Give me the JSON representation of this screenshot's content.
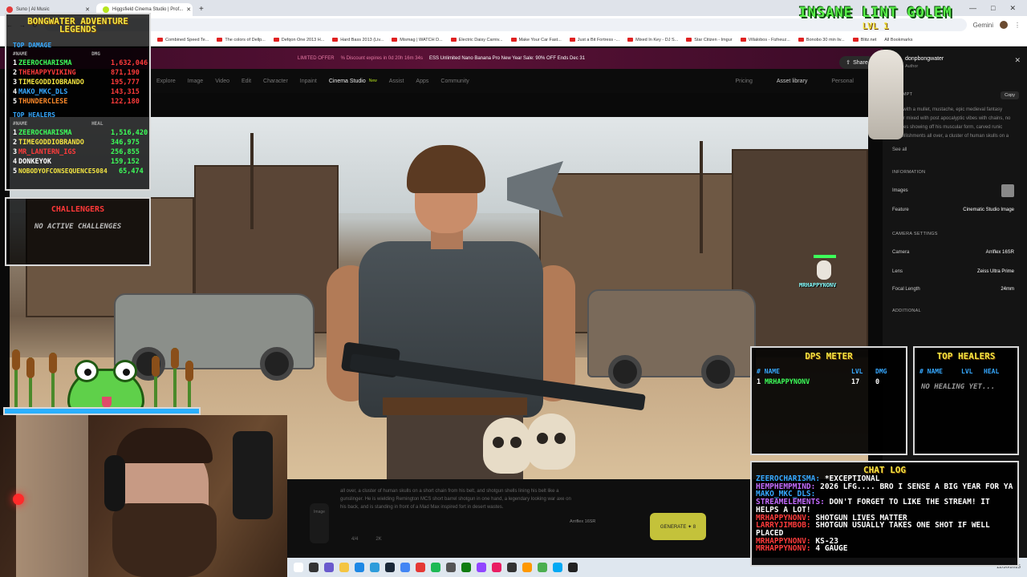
{
  "browser": {
    "tabs": [
      {
        "label": "Suno | AI Music",
        "active": false,
        "color": "#e33b3b"
      },
      {
        "label": "Higgsfield Cinema Studio | Prof...",
        "active": true,
        "color": "#b7e51e"
      }
    ],
    "new_tab": "+",
    "window_controls": [
      "—",
      "□",
      "✕"
    ],
    "bookmarks": [
      "Combined Speed Te...",
      "The colors of Dellp...",
      "Defqon One 2013 H...",
      "Hard Bass 2013 (Liv...",
      "Mismag | WATCH D...",
      "Electric Daisy Carniv...",
      "Make Your Car Fast...",
      "Just a Bit Fortress -...",
      "Mixed In Key - DJ S...",
      "Star Citizen - Imgur",
      "Villalobos - Fizheuz...",
      "Bonobo 30 min liv...",
      "Blitz.net"
    ],
    "all_bookmarks": "All Bookmarks",
    "gemini": "Gemini"
  },
  "promo": {
    "badge": "LIMITED OFFER",
    "discount": "% Discount expires in 0d 20h 16m 34s",
    "text": "ESS Unlimited Nano Banana Pro New Year Sale: 90% OFF Ends Dec 31"
  },
  "nav": {
    "items": [
      "Explore",
      "Image",
      "Video",
      "Edit",
      "Character",
      "Inpaint",
      "Cinema Studio",
      "Assist",
      "Apps",
      "Community"
    ],
    "current": "Cinema Studio",
    "new_badge": "New",
    "right": [
      "Pricing",
      "Asset library",
      "Personal"
    ],
    "share": "Share"
  },
  "side": {
    "author_name": "donpbongwater",
    "author_role": "Author",
    "prompt_label": "PROMPT",
    "copy": "Copy",
    "prompt_text": "...an with a mullet, mustache, epic medieval fantasy armor mixed with post apocalyptic vibes with chains, no sleeves showing off his muscular form, carved runic embellishments all over, a cluster of human skulls on a short chain from his",
    "see_all": "See all",
    "information_label": "INFORMATION",
    "images_label": "Images",
    "feature_label": "Feature",
    "feature_value": "Cinematic Studio Image",
    "camera_label": "CAMERA SETTINGS",
    "camera_key": "Camera",
    "camera_value": "Arriflex 16SR",
    "lens_key": "Lens",
    "lens_value": "Zeiss Ultra Prime",
    "focal_key": "Focal Length",
    "focal_value": "24mm",
    "additional_label": "ADDITIONAL"
  },
  "prompt_strip": {
    "text": "all over, a cluster of human skulls on a short chain from his belt, and shotgun shells lining his belt like a gunslinger. He is wielding Remington MCS short barrel shotgun in one hand, a legendary looking war axe on his back, and is standing in front of a Mad Max inspired fort in desert wastes.",
    "model": "Arriflex 16SR",
    "generate": "GENERATE ✦ 8",
    "pager_left": "4/4",
    "pager_right": "2K",
    "tools_label": "Image"
  },
  "taskbar": {
    "clock": "12/30/2025"
  },
  "legends": {
    "title_line1": "BONGWATER ADVENTURE",
    "title_line2": "LEGENDS",
    "damage_header": "TOP DAMAGE",
    "col_name": "#NAME",
    "col_dmg": "DMG",
    "damage": [
      {
        "rank": "1",
        "name": "ZEEROCHARISMA",
        "value": "1,632,046",
        "color": "#3dff5a"
      },
      {
        "rank": "2",
        "name": "THEHAPPYVIKING",
        "value": "871,190",
        "color": "#ff3b3b"
      },
      {
        "rank": "3",
        "name": "TIMEGODDIOBRANDO",
        "value": "195,777",
        "color": "#f4e542"
      },
      {
        "rank": "4",
        "name": "MAKO_MKC_DLS",
        "value": "143,315",
        "color": "#36a8ff"
      },
      {
        "rank": "5",
        "name": "THUNDERCLESE",
        "value": "122,180",
        "color": "#ff8a2a"
      }
    ],
    "healers_header": "TOP HEALERS",
    "col_heal": "HEAL",
    "healers": [
      {
        "rank": "1",
        "name": "ZEEROCHARISMA",
        "value": "1,516,420",
        "color": "#3dff5a"
      },
      {
        "rank": "2",
        "name": "TIMEGODDIOBRANDO",
        "value": "346,975",
        "color": "#f4e542"
      },
      {
        "rank": "3",
        "name": "MR_LANTERN_IGS",
        "value": "256,855",
        "color": "#ff3b3b"
      },
      {
        "rank": "4",
        "name": "DONKEYOK",
        "value": "159,152",
        "color": "#ffffff"
      },
      {
        "rank": "5",
        "name": "NOBODYOFCONSEQUENCE5084",
        "value": "65,474",
        "color": "#f4e542"
      }
    ]
  },
  "challenges": {
    "title": "CHALLENGERS",
    "subtitle": "NO ACTIVE CHALLENGES"
  },
  "golem": {
    "title": "INSANE LINT GOLEM",
    "level": "LVL 1"
  },
  "dps": {
    "title": "DPS METER",
    "cols": [
      "# NAME",
      "LVL",
      "DMG"
    ],
    "row": {
      "rank": "1",
      "name": "MRHAPPYNONV",
      "lvl": "17",
      "dmg": "0"
    }
  },
  "heal_panel": {
    "title": "TOP HEALERS",
    "cols": [
      "# NAME",
      "LVL",
      "HEAL"
    ],
    "empty": "NO HEALING YET..."
  },
  "chat": {
    "title": "CHAT LOG",
    "messages": [
      {
        "user": "ZEEROCHARISMA:",
        "text": "*EXCEPTIONAL",
        "color": "#36a8ff"
      },
      {
        "user": "HEMPHEMPMIND:",
        "text": "2026 LFG.... BRO I SENSE A BIG YEAR FOR YA",
        "color": "#c46bff"
      },
      {
        "user": "MAKO_MKC_DLS:",
        "text": "",
        "color": "#36a8ff"
      },
      {
        "user": "STREAMELEMENTS:",
        "text": "DON'T FORGET TO LIKE THE STREAM! IT HELPS A LOT!",
        "color": "#c46bff"
      },
      {
        "user": "MRHAPPYNONV:",
        "text": "SHOTGUN LIVES MATTER",
        "color": "#ff3b3b"
      },
      {
        "user": "LARRYJIMBOB:",
        "text": "SHOTGUN USUALLY TAKES ONE SHOT IF WELL PLACED",
        "color": "#ff3b3b"
      },
      {
        "user": "MRHAPPYNONV:",
        "text": "KS-23",
        "color": "#ff3b3b"
      },
      {
        "user": "MRHAPPYNONV:",
        "text": "4 GAUGE",
        "color": "#ff3b3b"
      }
    ]
  },
  "viewer": {
    "name": "MRHAPPYNONV"
  }
}
